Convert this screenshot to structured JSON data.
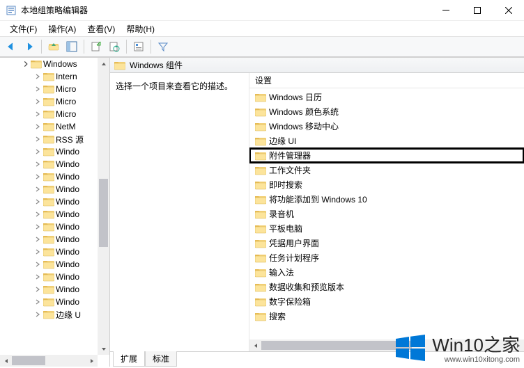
{
  "title": "本地组策略编辑器",
  "menus": [
    "文件(F)",
    "操作(A)",
    "查看(V)",
    "帮助(H)"
  ],
  "tree": {
    "root": {
      "label": "Windows",
      "expanded": true
    },
    "children": [
      "Intern",
      "Micro",
      "Micro",
      "Micro",
      "NetM",
      "RSS 源",
      "Windo",
      "Windo",
      "Windo",
      "Windo",
      "Windo",
      "Windo",
      "Windo",
      "Windo",
      "Windo",
      "Windo",
      "Windo",
      "Windo",
      "Windo",
      "边缘 U"
    ]
  },
  "content": {
    "header_label": "Windows 组件",
    "description": "选择一个项目来查看它的描述。",
    "column_header": "设置",
    "items": [
      {
        "label": "Windows 日历",
        "hl": false
      },
      {
        "label": "Windows 颜色系统",
        "hl": false
      },
      {
        "label": "Windows 移动中心",
        "hl": false
      },
      {
        "label": "边缘 UI",
        "hl": false
      },
      {
        "label": "附件管理器",
        "hl": true
      },
      {
        "label": "工作文件夹",
        "hl": false
      },
      {
        "label": "即时搜索",
        "hl": false
      },
      {
        "label": "将功能添加到 Windows 10",
        "hl": false
      },
      {
        "label": "录音机",
        "hl": false
      },
      {
        "label": "平板电脑",
        "hl": false
      },
      {
        "label": "凭据用户界面",
        "hl": false
      },
      {
        "label": "任务计划程序",
        "hl": false
      },
      {
        "label": "输入法",
        "hl": false
      },
      {
        "label": "数据收集和预览版本",
        "hl": false
      },
      {
        "label": "数字保险箱",
        "hl": false
      },
      {
        "label": "搜索",
        "hl": false
      }
    ]
  },
  "tabs": [
    "扩展",
    "标准"
  ],
  "watermark": {
    "brand": "Win10",
    "suffix": "之家",
    "url": "www.win10xitong.com"
  }
}
